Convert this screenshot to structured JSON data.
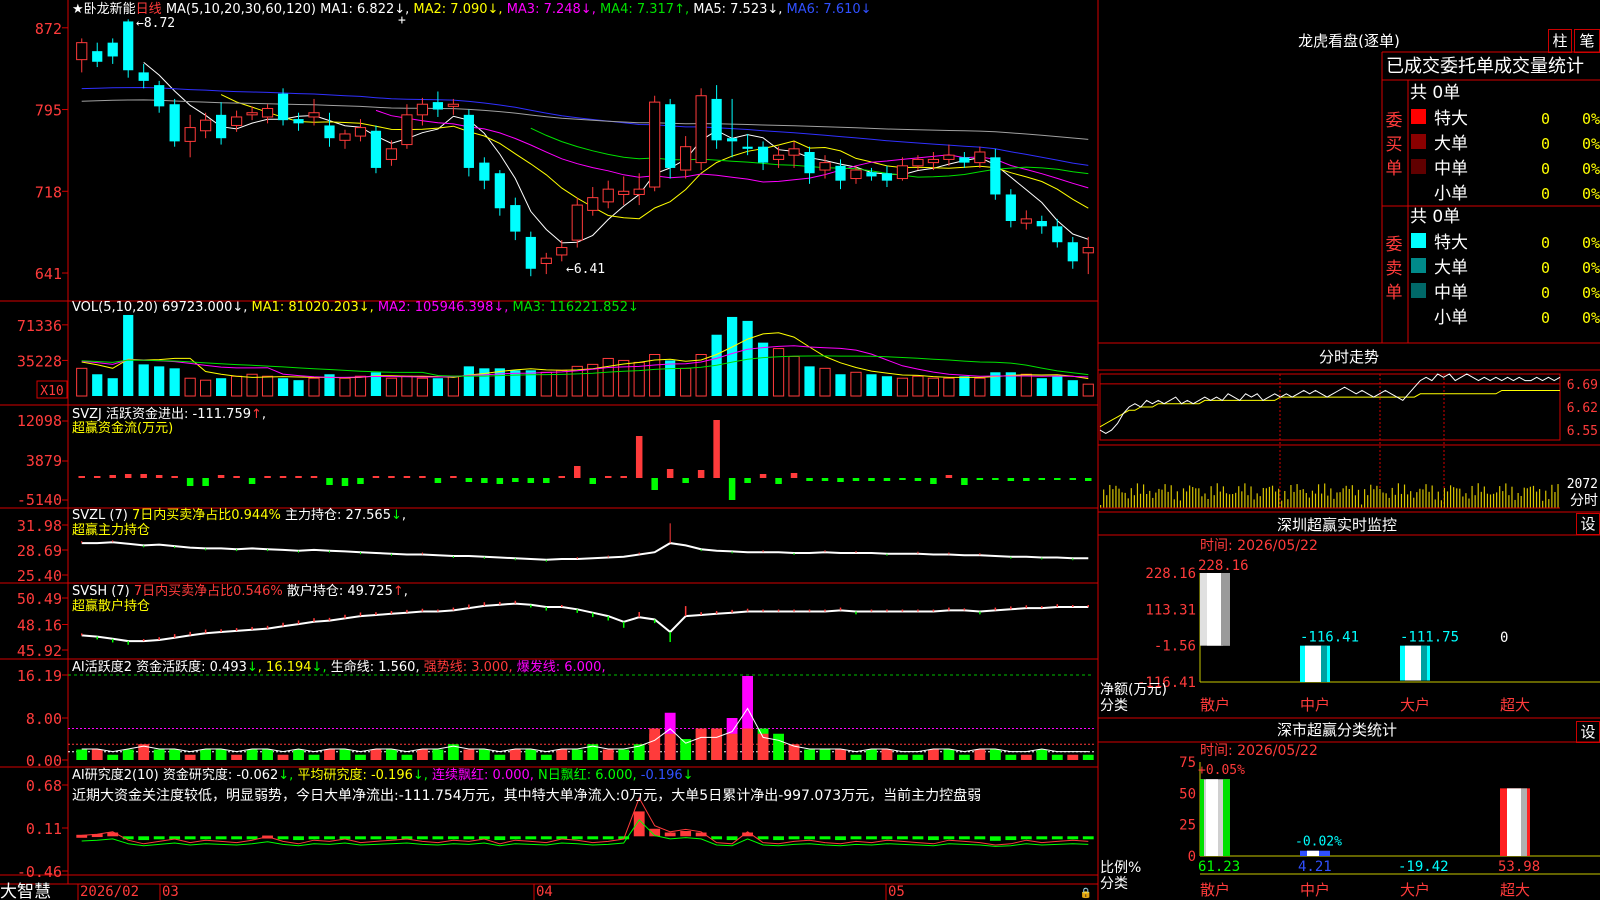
{
  "colors": {
    "up": "#ff3b3b",
    "down": "#00ffff",
    "grid": "#d40000",
    "ma1": "#ffffff",
    "ma2": "#ffff00",
    "ma3": "#ff00ff",
    "ma4": "#00e000",
    "ma5": "#3030ff",
    "ma6": "#a0a0a0",
    "vol_ma1": "#ffff00",
    "vol_ma2": "#ff00ff",
    "vol_ma3": "#00e000",
    "green": "#00ff00"
  },
  "kline": {
    "star": "★",
    "name": "卧龙新能",
    "period": "日线",
    "ma_label": "MA(5,10,20,30,60,120)",
    "ma": [
      {
        "label": "MA1:",
        "value": "6.822",
        "arrow": "↓"
      },
      {
        "label": "MA2:",
        "value": "7.090",
        "arrow": "↓"
      },
      {
        "label": "MA3:",
        "value": "7.248",
        "arrow": "↓"
      },
      {
        "label": "MA4:",
        "value": "7.317",
        "arrow": "↑"
      },
      {
        "label": "MA5:",
        "value": "7.523",
        "arrow": "↓"
      },
      {
        "label": "MA6:",
        "value": "7.610",
        "arrow": "↓"
      }
    ],
    "y_ticks": [
      "872",
      "795",
      "718",
      "641"
    ],
    "y_range": [
      625,
      885
    ],
    "high_mark": "8.72",
    "low_mark": "6.41",
    "marker": "+",
    "candles": [
      [
        842,
        858,
        830,
        862
      ],
      [
        850,
        840,
        835,
        858
      ],
      [
        858,
        845,
        838,
        862
      ],
      [
        878,
        832,
        825,
        880
      ],
      [
        830,
        822,
        815,
        838
      ],
      [
        818,
        798,
        792,
        822
      ],
      [
        800,
        765,
        760,
        805
      ],
      [
        765,
        778,
        750,
        790
      ],
      [
        775,
        785,
        768,
        792
      ],
      [
        790,
        768,
        762,
        802
      ],
      [
        780,
        788,
        774,
        794
      ],
      [
        790,
        792,
        785,
        798
      ],
      [
        788,
        796,
        782,
        800
      ],
      [
        810,
        785,
        780,
        815
      ],
      [
        786,
        782,
        775,
        792
      ],
      [
        788,
        792,
        780,
        805
      ],
      [
        780,
        768,
        760,
        792
      ],
      [
        766,
        772,
        758,
        776
      ],
      [
        770,
        778,
        765,
        786
      ],
      [
        775,
        740,
        735,
        780
      ],
      [
        748,
        758,
        742,
        766
      ],
      [
        762,
        790,
        758,
        800
      ],
      [
        790,
        800,
        780,
        806
      ],
      [
        802,
        795,
        788,
        812
      ],
      [
        798,
        800,
        790,
        805
      ],
      [
        790,
        740,
        732,
        795
      ],
      [
        745,
        728,
        720,
        750
      ],
      [
        735,
        702,
        695,
        738
      ],
      [
        705,
        680,
        672,
        712
      ],
      [
        675,
        645,
        638,
        680
      ],
      [
        650,
        655,
        640,
        660
      ],
      [
        658,
        665,
        652,
        672
      ],
      [
        672,
        705,
        665,
        712
      ],
      [
        700,
        712,
        695,
        722
      ],
      [
        708,
        720,
        702,
        728
      ],
      [
        715,
        718,
        705,
        732
      ],
      [
        715,
        720,
        705,
        735
      ],
      [
        722,
        802,
        718,
        808
      ],
      [
        800,
        740,
        730,
        805
      ],
      [
        738,
        760,
        730,
        770
      ],
      [
        745,
        808,
        738,
        815
      ],
      [
        805,
        766,
        758,
        818
      ],
      [
        768,
        765,
        750,
        805
      ],
      [
        760,
        758,
        752,
        772
      ],
      [
        760,
        745,
        738,
        765
      ],
      [
        748,
        752,
        740,
        760
      ],
      [
        752,
        758,
        740,
        765
      ],
      [
        755,
        735,
        725,
        760
      ],
      [
        738,
        745,
        730,
        752
      ],
      [
        742,
        728,
        720,
        748
      ],
      [
        730,
        738,
        725,
        742
      ],
      [
        736,
        732,
        728,
        740
      ],
      [
        735,
        728,
        722,
        742
      ],
      [
        730,
        742,
        728,
        750
      ],
      [
        742,
        748,
        738,
        752
      ],
      [
        745,
        748,
        738,
        755
      ],
      [
        748,
        752,
        742,
        762
      ],
      [
        750,
        745,
        740,
        755
      ],
      [
        745,
        755,
        740,
        760
      ],
      [
        750,
        715,
        710,
        758
      ],
      [
        715,
        690,
        684,
        720
      ],
      [
        688,
        692,
        682,
        700
      ],
      [
        690,
        685,
        678,
        695
      ],
      [
        685,
        670,
        665,
        692
      ],
      [
        670,
        652,
        645,
        675
      ],
      [
        660,
        665,
        640,
        675
      ]
    ]
  },
  "vol": {
    "label": "VOL(5,10,20)",
    "value": "69723.000",
    "value_arrow": "↓",
    "ma": [
      {
        "label": "MA1:",
        "value": "81020.203",
        "arrow": "↓"
      },
      {
        "label": "MA2:",
        "value": "105946.398",
        "arrow": "↓"
      },
      {
        "label": "MA3:",
        "value": "116221.852",
        "arrow": "↓"
      }
    ],
    "y_ticks": [
      "71336",
      "35228"
    ],
    "unit_tag": "X10",
    "values": [
      28,
      22,
      18,
      82,
      32,
      30,
      28,
      18,
      16,
      18,
      20,
      22,
      20,
      18,
      16,
      18,
      22,
      18,
      20,
      24,
      18,
      20,
      18,
      18,
      20,
      30,
      28,
      28,
      26,
      26,
      24,
      26,
      30,
      32,
      38,
      36,
      34,
      42,
      36,
      28,
      42,
      62,
      80,
      76,
      54,
      48,
      40,
      30,
      28,
      22,
      24,
      22,
      20,
      18,
      20,
      18,
      18,
      20,
      18,
      24,
      24,
      22,
      18,
      20,
      16,
      12
    ]
  },
  "svzj": {
    "label": "SVZJ",
    "title": "活跃资金进出:",
    "value": "-111.759",
    "arrow": "↑",
    "comma": ",",
    "subtitle": "超赢资金流(万元)",
    "y_ticks": [
      "12098",
      "3879",
      "-5140"
    ],
    "values": [
      0,
      0,
      0,
      1.2,
      1.1,
      1.3,
      0,
      -1.8,
      -1.2,
      0.9,
      0,
      -1.0,
      0,
      0,
      0,
      0,
      -1.1,
      -1.3,
      -1.0,
      0,
      0,
      0,
      0,
      0,
      0,
      0,
      0,
      -1.0,
      0,
      0,
      0,
      0,
      -1.1,
      0,
      0,
      0,
      3.5,
      0,
      0,
      -1.2,
      0,
      0,
      0,
      0,
      -1.0,
      0,
      0,
      0,
      0,
      -1.2,
      0,
      0,
      0,
      0,
      -1.0,
      -1.0,
      0,
      0,
      0,
      0,
      -1.1,
      0,
      0,
      0,
      0,
      0,
      0,
      0,
      0,
      0,
      0,
      0,
      0,
      0,
      0,
      0,
      0,
      0,
      0,
      0,
      0,
      0,
      0,
      0,
      0
    ]
  },
  "svzl": {
    "label": "SVZL",
    "params": "(7)",
    "desc": "7日内买卖净占比0.944%",
    "name": "主力持仓:",
    "value": "27.565",
    "arrow": "↓",
    "comma": ",",
    "subtitle": "超赢主力持仓",
    "y_ticks": [
      "31.98",
      "28.69",
      "25.40"
    ],
    "values": [
      29.6,
      29.6,
      29.7,
      29.5,
      29.3,
      29.4,
      29.2,
      29.0,
      28.9,
      28.9,
      28.8,
      28.9,
      28.8,
      28.7,
      28.6,
      28.7,
      28.6,
      28.5,
      28.4,
      28.3,
      28.2,
      28.1,
      28.1,
      28.0,
      27.9,
      27.9,
      27.8,
      27.7,
      27.6,
      27.5,
      27.4,
      27.5,
      27.5,
      27.6,
      27.7,
      27.8,
      28.1,
      28.4,
      29.6,
      29.3,
      28.8,
      28.6,
      28.5,
      28.4,
      28.4,
      28.4,
      28.3,
      28.3,
      28.4,
      28.3,
      28.3,
      28.3,
      28.2,
      28.2,
      28.2,
      28.1,
      28.1,
      28.0,
      28.0,
      27.9,
      27.8,
      27.8,
      27.7,
      27.7,
      27.6,
      27.6
    ]
  },
  "svsh": {
    "label": "SVSH",
    "params": "(7)",
    "desc": "7日内买卖净占比0.546%",
    "name": "散户持仓:",
    "value": "49.725",
    "arrow": "↑",
    "comma": ",",
    "subtitle": "超赢散户持仓",
    "y_ticks": [
      "50.49",
      "48.16",
      "45.92"
    ],
    "values": [
      47.2,
      47.1,
      46.9,
      46.7,
      46.7,
      46.8,
      47.0,
      47.2,
      47.4,
      47.5,
      47.6,
      47.7,
      47.8,
      48.0,
      48.2,
      48.4,
      48.5,
      48.7,
      48.9,
      49.0,
      49.1,
      49.2,
      49.3,
      49.3,
      49.4,
      49.6,
      49.8,
      49.9,
      50.0,
      49.9,
      49.7,
      49.7,
      49.5,
      49.2,
      48.9,
      48.4,
      48.8,
      48.6,
      47.5,
      48.9,
      49.0,
      49.1,
      49.2,
      49.3,
      49.3,
      49.3,
      49.3,
      49.3,
      49.3,
      49.4,
      49.3,
      49.3,
      49.3,
      49.3,
      49.3,
      49.3,
      49.4,
      49.4,
      49.3,
      49.4,
      49.5,
      49.6,
      49.6,
      49.7,
      49.7,
      49.7
    ]
  },
  "ai2": {
    "label": "AI活跃度2",
    "desc": "资金活跃度:",
    "value": "0.493",
    "arrow": "↓",
    "v2": "16.194",
    "life_label": "生命线:",
    "life": "1.560",
    "strong_label": "强势线:",
    "strong": "3.000",
    "burst_label": "爆发线:",
    "burst": "6.000",
    "comma": ",",
    "y_ticks": [
      "16.19",
      "8.00",
      "0.00"
    ],
    "values": [
      2,
      2,
      1,
      2,
      3,
      2,
      2,
      1,
      2,
      2,
      1,
      2,
      2,
      1,
      2,
      1,
      2,
      2,
      1,
      2,
      2,
      1,
      2,
      2,
      3,
      2,
      2,
      1,
      2,
      2,
      1,
      2,
      2,
      3,
      2,
      2,
      3,
      5,
      9,
      4,
      6,
      6,
      8,
      16,
      6,
      5,
      3,
      2,
      2,
      2,
      1,
      2,
      2,
      1,
      1,
      2,
      2,
      1,
      2,
      2,
      1,
      1,
      2,
      1,
      1,
      1
    ]
  },
  "ai_research": {
    "label": "AI研究度2(10)",
    "desc": "资金研究度:",
    "value": "-0.062",
    "arrow": "↓",
    "avg_label": "平均研究度:",
    "avg": "-0.196",
    "cont_label": "连续飘红:",
    "cont": "0.000",
    "n_label": "N日飘红:",
    "n": "6.000",
    "last": "-0.196",
    "comment": "近期大资金关注度较低，明显弱势，今日大单净流出:-111.754万元，其中特大单净流入:0万元，大单5日累计净出-997.073万元，当前主力控盘弱",
    "y_ticks": [
      "0.68",
      "0.11",
      "-0.46"
    ],
    "values": [
      0.02,
      0.03,
      0.05,
      -0.02,
      -0.05,
      -0.03,
      -0.01,
      -0.04,
      -0.02,
      -0.03,
      -0.04,
      -0.02,
      0.01,
      -0.03,
      -0.05,
      -0.02,
      -0.03,
      -0.01,
      -0.04,
      -0.03,
      -0.02,
      -0.01,
      -0.03,
      -0.04,
      -0.02,
      -0.03,
      -0.01,
      -0.05,
      -0.02,
      -0.03,
      -0.04,
      -0.01,
      -0.02,
      -0.04,
      -0.03,
      -0.01,
      0.33,
      0.1,
      0.05,
      0.07,
      0.05,
      -0.04,
      -0.05,
      0.05,
      -0.04,
      -0.05,
      -0.03,
      -0.02,
      -0.04,
      -0.05,
      -0.03,
      -0.04,
      -0.02,
      -0.03,
      -0.04,
      -0.05,
      -0.02,
      -0.03,
      -0.04,
      -0.06,
      -0.05,
      -0.02,
      -0.04,
      -0.03,
      -0.02,
      -0.03
    ]
  },
  "footer": {
    "brand": "大智慧",
    "dates": [
      "2026/02",
      "03",
      "04",
      "05"
    ]
  },
  "dragon": {
    "title": "龙虎看盘(逐单)",
    "btn1": "柱",
    "btn2": "笔",
    "subtitle": "已成交委托单成交量统计",
    "buy_label": "委买单",
    "sell_label": "委卖单",
    "buy_total": "共 0单",
    "sell_total": "共 0单",
    "buy_rows": [
      {
        "name": "特大",
        "color": "#ff0000",
        "count": "0",
        "pct": "0%"
      },
      {
        "name": "大单",
        "color": "#8a0000",
        "count": "0",
        "pct": "0%"
      },
      {
        "name": "中单",
        "color": "#600000",
        "count": "0",
        "pct": "0%"
      },
      {
        "name": "小单",
        "color": "",
        "count": "0",
        "pct": "0%"
      }
    ],
    "sell_rows": [
      {
        "name": "特大",
        "color": "#00ffff",
        "count": "0",
        "pct": "0%"
      },
      {
        "name": "大单",
        "color": "#008a8a",
        "count": "0",
        "pct": "0%"
      },
      {
        "name": "中单",
        "color": "#006868",
        "count": "0",
        "pct": "0%"
      },
      {
        "name": "小单",
        "color": "",
        "count": "0",
        "pct": "0%"
      }
    ]
  },
  "intraday": {
    "title": "分时走势",
    "y_ticks": [
      "6.69",
      "6.62",
      "6.55"
    ],
    "vol_label": "2072",
    "unit_label": "分时",
    "price": [
      6.55,
      6.54,
      6.55,
      6.57,
      6.6,
      6.62,
      6.63,
      6.62,
      6.64,
      6.63,
      6.64,
      6.63,
      6.64,
      6.65,
      6.63,
      6.64,
      6.63,
      6.64,
      6.65,
      6.64,
      6.65,
      6.64,
      6.66,
      6.65,
      6.64,
      6.66,
      6.65,
      6.66,
      6.64,
      6.65,
      6.66,
      6.65,
      6.66,
      6.65,
      6.66,
      6.67,
      6.66,
      6.67,
      6.66,
      6.65,
      6.66,
      6.67,
      6.68,
      6.67,
      6.66,
      6.67,
      6.66,
      6.65,
      6.66,
      6.67,
      6.66,
      6.65,
      6.64,
      6.66,
      6.68,
      6.7,
      6.71,
      6.7,
      6.72,
      6.71,
      6.72,
      6.7,
      6.71,
      6.72,
      6.71,
      6.7,
      6.71,
      6.7,
      6.71,
      6.7,
      6.71,
      6.7,
      6.71,
      6.7,
      6.7,
      6.71,
      6.7,
      6.71,
      6.7,
      6.71
    ],
    "avg": [
      6.56,
      6.57,
      6.58,
      6.59,
      6.6,
      6.61,
      6.61,
      6.62,
      6.62,
      6.62,
      6.63,
      6.63,
      6.63,
      6.63,
      6.63,
      6.63,
      6.63,
      6.63,
      6.64,
      6.64,
      6.64,
      6.64,
      6.64,
      6.64,
      6.64,
      6.64,
      6.64,
      6.64,
      6.64,
      6.64,
      6.64,
      6.65,
      6.65,
      6.65,
      6.65,
      6.65,
      6.65,
      6.65,
      6.65,
      6.65,
      6.65,
      6.65,
      6.65,
      6.65,
      6.65,
      6.65,
      6.65,
      6.65,
      6.65,
      6.65,
      6.65,
      6.65,
      6.65,
      6.65,
      6.65,
      6.66,
      6.66,
      6.66,
      6.66,
      6.66,
      6.66,
      6.66,
      6.66,
      6.66,
      6.66,
      6.66,
      6.66,
      6.66,
      6.66,
      6.67,
      6.67,
      6.67,
      6.67,
      6.67,
      6.67,
      6.67,
      6.67,
      6.67,
      6.67,
      6.67
    ],
    "ref": 6.69,
    "range": [
      6.52,
      6.72
    ]
  },
  "sz_monitor": {
    "title": "深圳超赢实时监控",
    "btn": "设",
    "time": "时间: 2026/05/22",
    "y_ticks": [
      "228.16",
      "113.31",
      "-1.56",
      "-116.41"
    ],
    "ylabel": "净额(万元)",
    "xlabel": "分类",
    "categories": [
      "散户",
      "中户",
      "大户",
      "超大"
    ],
    "values": [
      228.16,
      -116.41,
      -111.75,
      0
    ],
    "value_labels": [
      "228.16",
      "-116.41",
      "-111.75",
      "0"
    ]
  },
  "sz_class": {
    "title": "深市超赢分类统计",
    "btn": "设",
    "time": "时间: 2026/05/22",
    "y_ticks": [
      "75",
      "50",
      "25",
      "0"
    ],
    "ylabel": "比例%",
    "xlabel": "分类",
    "categories": [
      "散户",
      "中户",
      "大户",
      "超大"
    ],
    "values": [
      61.23,
      4.21,
      -19.42,
      53.98
    ],
    "top_labels": [
      "+0.05%",
      "-0.02%",
      "",
      ""
    ],
    "bottom_labels": [
      "61.23",
      "4.21",
      "-19.42",
      "53.98"
    ]
  }
}
